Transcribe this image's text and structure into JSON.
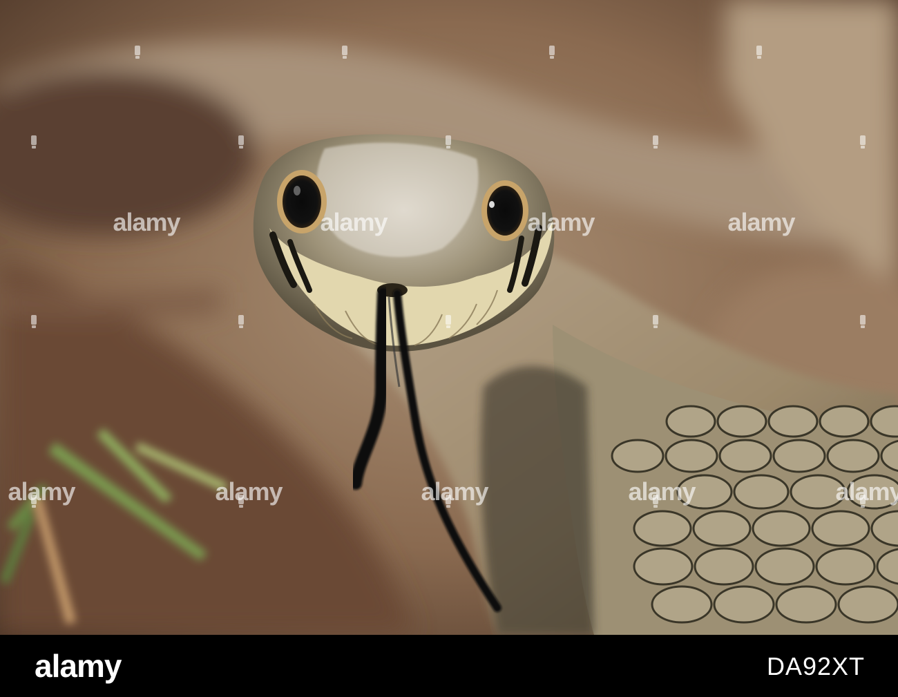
{
  "photo": {
    "subject": "grass snake head close-up with forked tongue",
    "palette": {
      "background_warm": "#9a7a5c",
      "background_dark": "#3b2a20",
      "scale_olive": "#a39578",
      "scale_dark": "#2a2a20",
      "lip_cream": "#e8ddb8",
      "eye_ring": "#c8a46a",
      "tongue": "#101010",
      "grass": "#6a8a4a"
    }
  },
  "watermark": {
    "text": "alamy"
  },
  "footer": {
    "brand": "alamy",
    "image_id": "DA92XT"
  }
}
